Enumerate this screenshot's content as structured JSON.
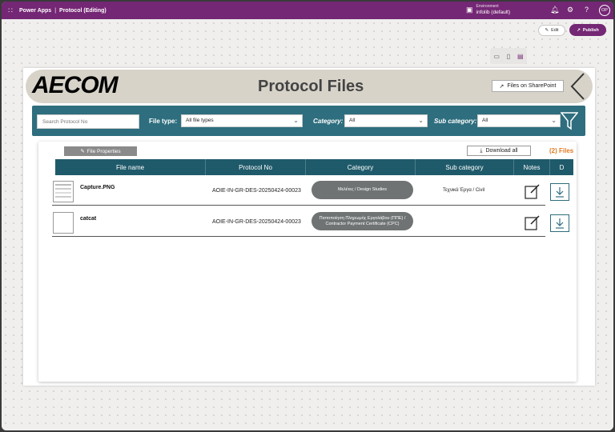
{
  "topbar": {
    "app_name": "Power Apps",
    "separator": "|",
    "doc_title": "Protocol (Editing)",
    "env_label": "Environment",
    "env_name": "infolib (default)",
    "avatar": "OP"
  },
  "toolbar": {
    "edit_label": "Edit",
    "publish_label": "Publish"
  },
  "header": {
    "logo_text": "AECOM",
    "title": "Protocol Files",
    "sharepoint_label": "Files on SharePoint"
  },
  "filters": {
    "search_placeholder": "Search Protocol No",
    "file_type_label": "File type:",
    "file_type_value": "All file types",
    "category_label": "Category:",
    "category_value": "All",
    "subcategory_label": "Sub category:",
    "subcategory_value": "All"
  },
  "panel": {
    "file_properties_label": "File Properties",
    "download_all_label": "Download all",
    "count_label": "(2) Files"
  },
  "table": {
    "headers": [
      "File name",
      "Protocol No",
      "Category",
      "Sub category",
      "Notes",
      "D"
    ],
    "rows": [
      {
        "file_name": "Capture.PNG",
        "protocol_no": "AOIE-IN-GR-DES-20250424-00023",
        "category": "Μελέτες / Design Studies",
        "sub_category": "Τεχνικά Έργα / Civil"
      },
      {
        "file_name": "catcat",
        "protocol_no": "AOIE-IN-GR-DES-20250424-00023",
        "category": "Πιστοποίηση Πληρωμής Εργολάβου (ΠΠΕ) / Contractor Payment Certificate (CPC)",
        "sub_category": ""
      }
    ]
  },
  "colors": {
    "brand": "#742774",
    "filterbar": "#2e6e7e",
    "table_header": "#1f5a6a",
    "count_accent": "#e07b24"
  }
}
